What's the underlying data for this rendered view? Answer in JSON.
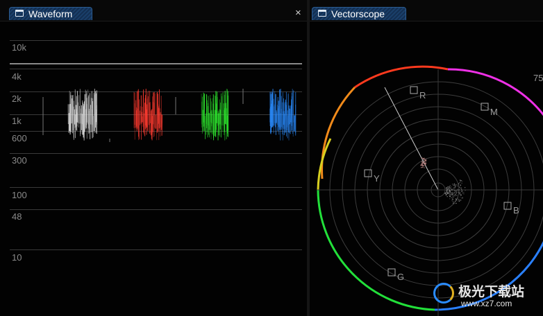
{
  "waveform": {
    "tab_label": "Waveform",
    "close_label": "×",
    "scale_labels": [
      "10k",
      "4k",
      "2k",
      "1k",
      "600",
      "300",
      "100",
      "48",
      "10"
    ]
  },
  "vectorscope": {
    "tab_label": "Vectorscope",
    "percent_label": "75",
    "targets": [
      "R",
      "M",
      "Y",
      "B",
      "G"
    ]
  },
  "watermark": {
    "text": "极光下载站",
    "url": "www.xz7.com"
  },
  "colors": {
    "tab_blue": "#1a3f6a",
    "red_channel": "#ff3b30",
    "green_channel": "#2ee62e",
    "blue_channel": "#2a8cff",
    "luma": "#e8e8e8"
  }
}
